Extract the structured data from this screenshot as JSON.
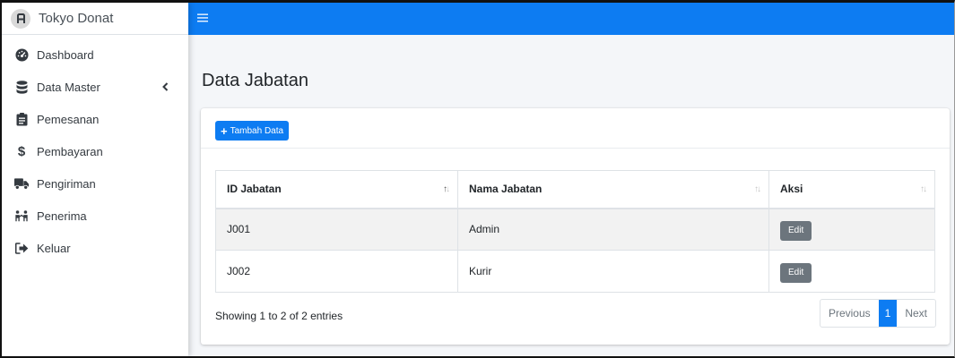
{
  "brand": {
    "name": "Tokyo Donat",
    "logo_icon": "cube-icon"
  },
  "sidebar": {
    "items": [
      {
        "label": "Dashboard",
        "icon": "tachometer-icon"
      },
      {
        "label": "Data Master",
        "icon": "database-icon",
        "has_submenu": true
      },
      {
        "label": "Pemesanan",
        "icon": "clipboard-icon"
      },
      {
        "label": "Pembayaran",
        "icon": "dollar-icon"
      },
      {
        "label": "Pengiriman",
        "icon": "truck-icon"
      },
      {
        "label": "Penerima",
        "icon": "users-icon"
      },
      {
        "label": "Keluar",
        "icon": "sign-out-icon"
      }
    ]
  },
  "topbar": {
    "menu_icon": "hamburger-icon"
  },
  "page": {
    "title": "Data Jabatan",
    "add_button_label": "Tambah Data"
  },
  "table": {
    "headers": [
      "ID Jabatan",
      "Nama Jabatan",
      "Aksi"
    ],
    "rows": [
      {
        "id": "J001",
        "nama": "Admin",
        "action": "Edit"
      },
      {
        "id": "J002",
        "nama": "Kurir",
        "action": "Edit"
      }
    ]
  },
  "footer": {
    "info": "Showing 1 to 2 of 2 entries",
    "pagination": {
      "previous": "Previous",
      "current": "1",
      "next": "Next"
    }
  },
  "colors": {
    "primary": "#0d7cf2",
    "secondary": "#6c757d",
    "content_bg": "#f4f6f9"
  }
}
